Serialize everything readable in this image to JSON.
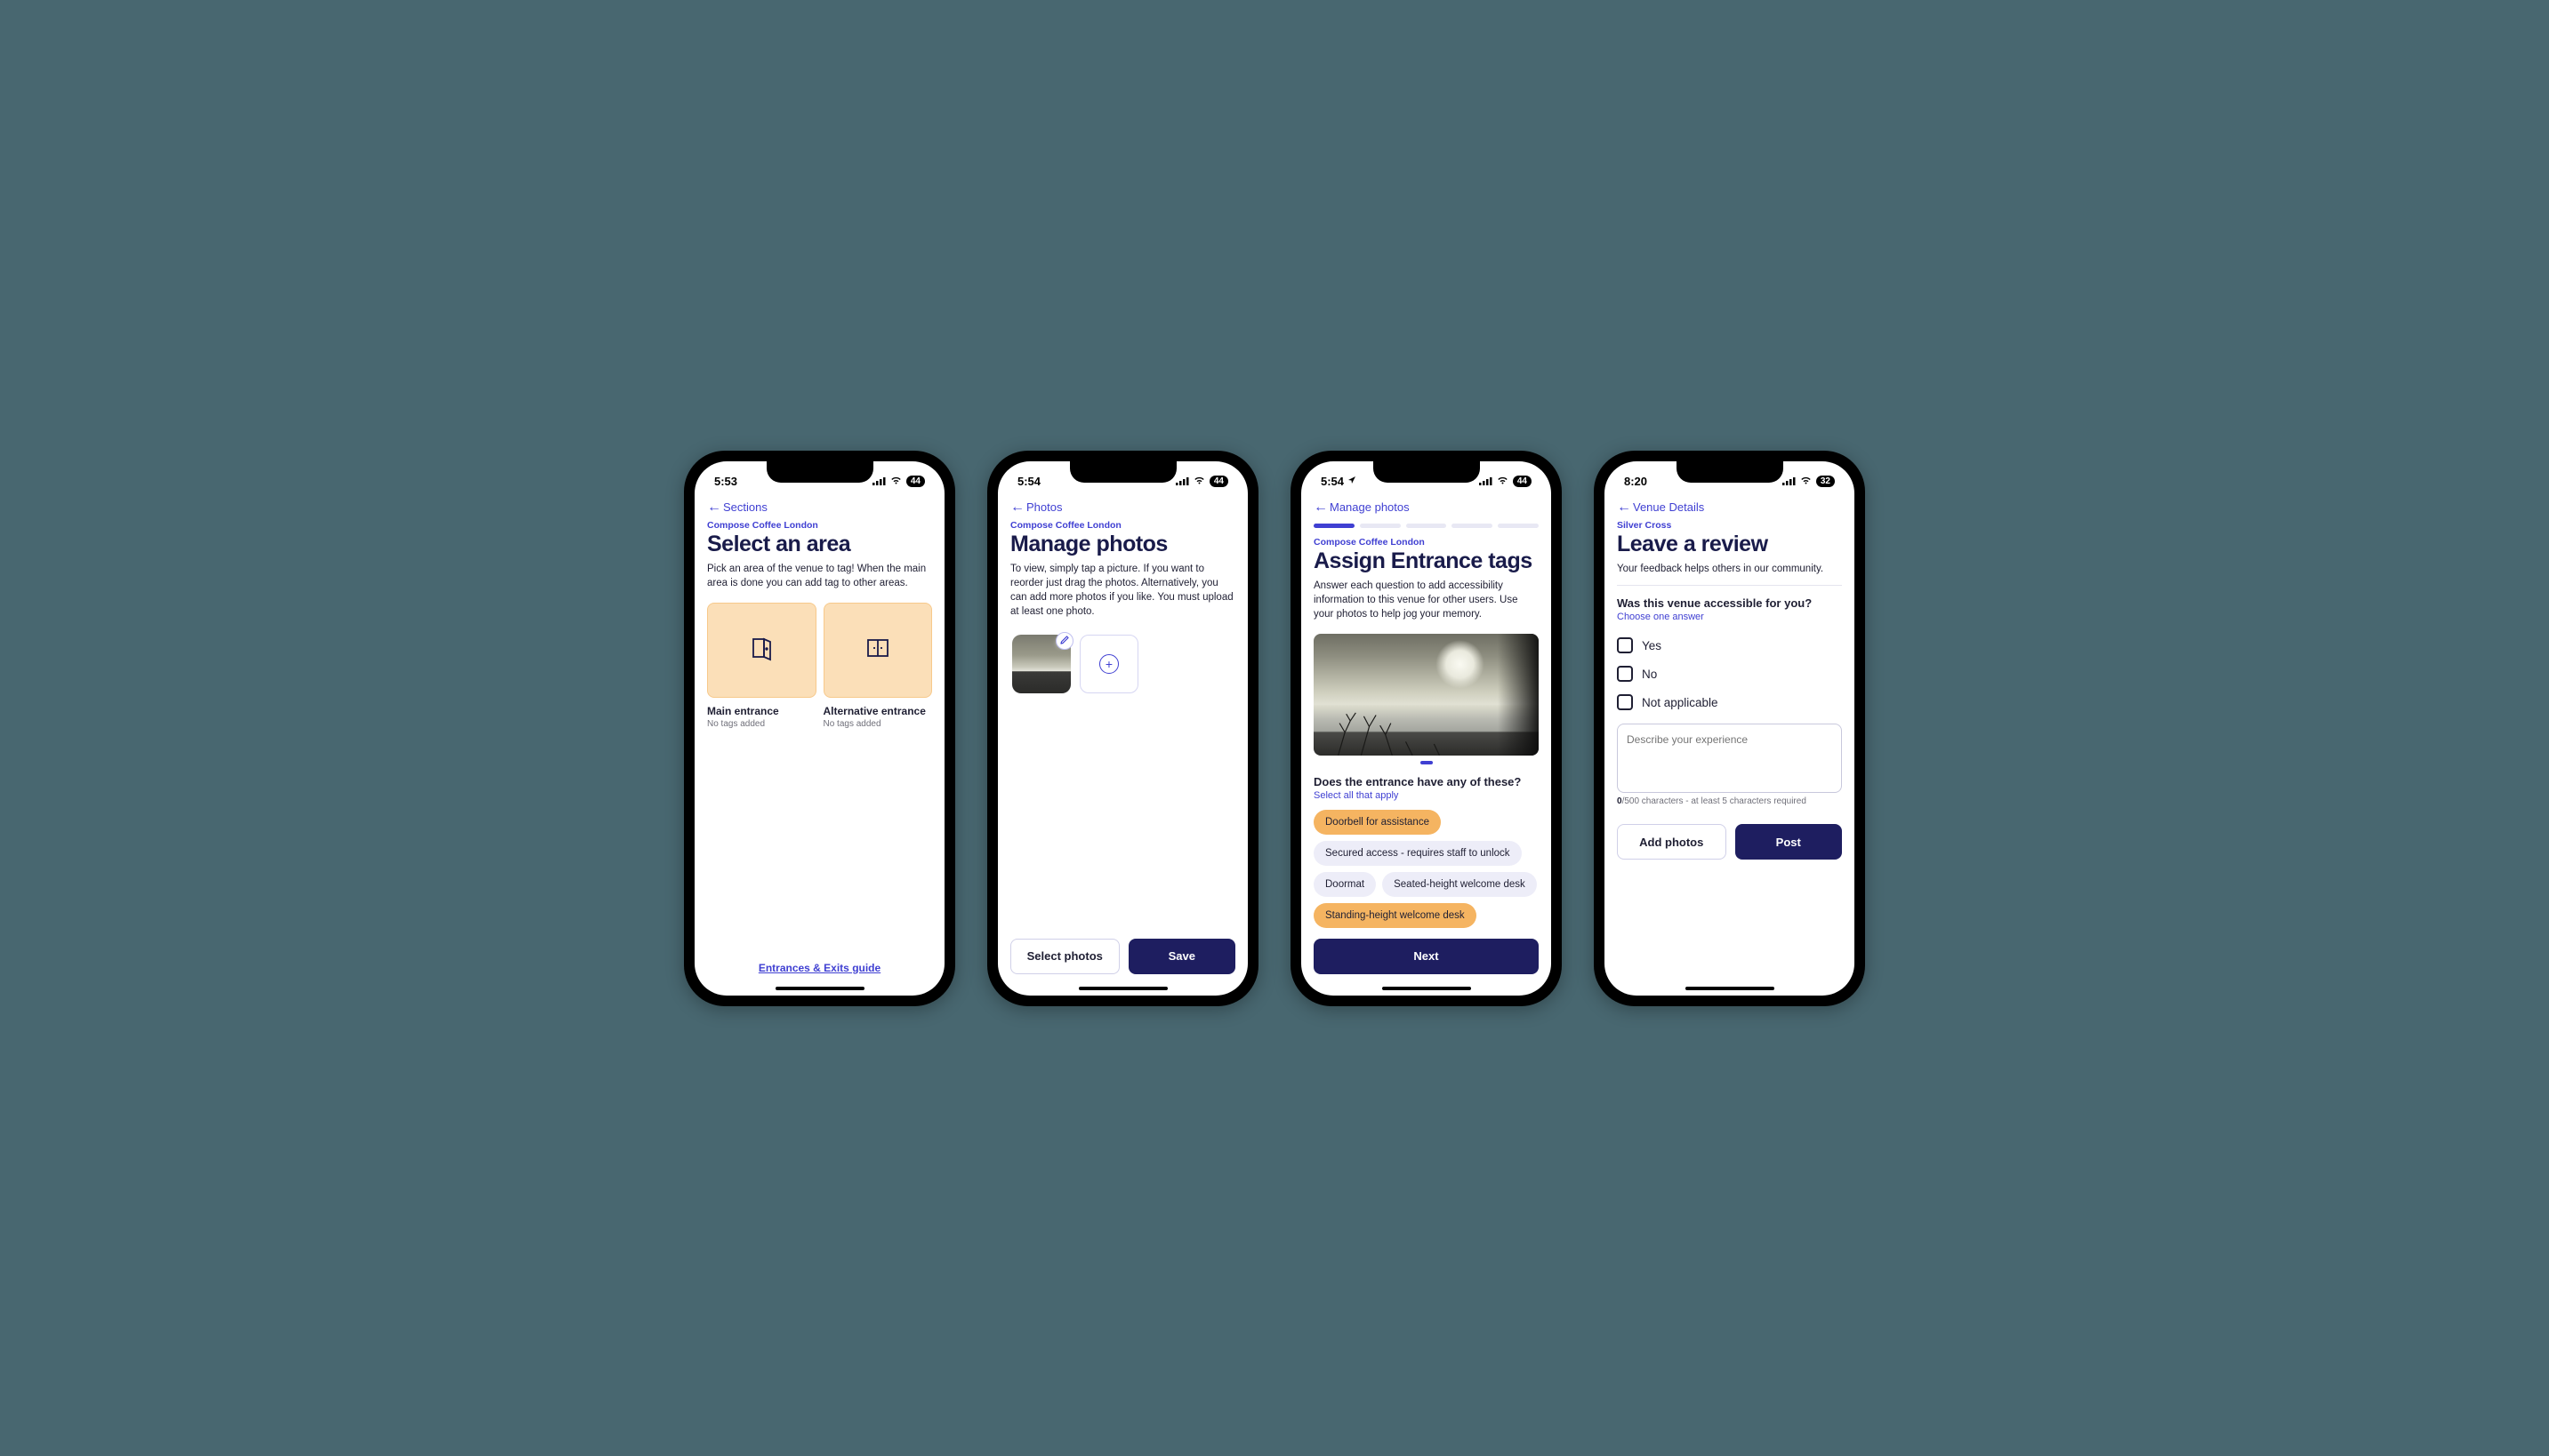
{
  "screens": [
    {
      "status": {
        "time": "5:53",
        "battery": "44"
      },
      "back_label": "Sections",
      "breadcrumb": "Compose Coffee London",
      "title": "Select an area",
      "subtitle": "Pick an area of the venue to tag! When the main area is done you can add tag to other areas.",
      "tiles": [
        {
          "label": "Main entrance",
          "sub": "No tags added",
          "icon": "door-open"
        },
        {
          "label": "Alternative entrance",
          "sub": "No tags added",
          "icon": "door-double"
        }
      ],
      "footer_link": "Entrances & Exits guide"
    },
    {
      "status": {
        "time": "5:54",
        "battery": "44"
      },
      "back_label": "Photos",
      "breadcrumb": "Compose Coffee London",
      "title": "Manage photos",
      "subtitle": "To view, simply tap a picture. If you want to reorder just drag the photos. Alternatively, you can add more photos if you like. You must upload at least one photo.",
      "buttons": {
        "secondary": "Select photos",
        "primary": "Save"
      }
    },
    {
      "status": {
        "time": "5:54",
        "battery": "44",
        "location": true
      },
      "back_label": "Manage photos",
      "progress_segments": 5,
      "progress_active": 1,
      "breadcrumb": "Compose Coffee London",
      "title": "Assign Entrance tags",
      "subtitle": "Answer each question to add accessibility information to this venue for other users. Use your photos to help jog your memory.",
      "question": "Does the entrance have any of these?",
      "instruction": "Select all that apply",
      "chips": [
        {
          "label": "Doorbell for assistance",
          "selected": true
        },
        {
          "label": "Secured access - requires staff to unlock",
          "selected": false
        },
        {
          "label": "Doormat",
          "selected": false
        },
        {
          "label": "Seated-height welcome desk",
          "selected": false
        },
        {
          "label": "Standing-height welcome desk",
          "selected": true
        }
      ],
      "primary_button": "Next"
    },
    {
      "status": {
        "time": "8:20",
        "battery": "32"
      },
      "back_label": "Venue Details",
      "breadcrumb": "Silver Cross",
      "title": "Leave a review",
      "subtitle": "Your feedback helps others in our community.",
      "question": "Was this venue accessible for you?",
      "instruction": "Choose one answer",
      "options": [
        "Yes",
        "No",
        "Not applicable"
      ],
      "textarea_placeholder": "Describe your experience",
      "char_note_count": "0",
      "char_note_rest": "/500 characters - at least 5 characters required",
      "buttons": {
        "secondary": "Add photos",
        "primary": "Post"
      }
    }
  ]
}
